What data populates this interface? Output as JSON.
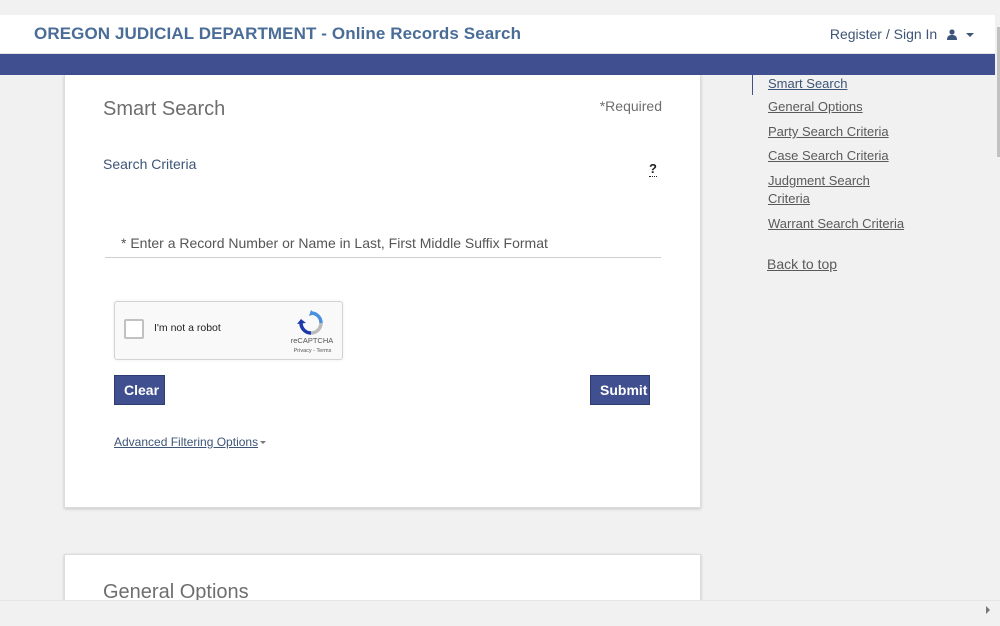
{
  "header": {
    "title": "OREGON JUDICIAL DEPARTMENT - Online Records Search",
    "account_label": "Register / Sign In"
  },
  "smart_search": {
    "title": "Smart Search",
    "required_label": "*Required",
    "criteria_label": "Search Criteria",
    "help_label": "?",
    "search_placeholder": "* Enter a Record Number or Name in Last, First Middle Suffix Format",
    "search_value": "",
    "captcha": {
      "label": "I'm not a robot",
      "brand": "reCAPTCHA",
      "terms": "Privacy - Terms"
    },
    "clear_label": "Clear",
    "submit_label": "Submit",
    "advanced_label": "Advanced Filtering Options"
  },
  "general_options": {
    "title": "General Options"
  },
  "sidenav": {
    "items": [
      {
        "label": "Smart Search"
      },
      {
        "label": "General Options"
      },
      {
        "label": "Party Search Criteria"
      },
      {
        "label": "Case Search Criteria"
      },
      {
        "label": "Judgment Search Criteria"
      },
      {
        "label": "Warrant Search Criteria"
      }
    ],
    "back_to_top": "Back to top"
  },
  "colors": {
    "brand_text": "#4a6d97",
    "nav_bar": "#3f4f8f",
    "button": "#3f4f8f",
    "link": "#3d5577"
  },
  "icons": {
    "account": "user-icon",
    "captcha": "recaptcha-logo-icon"
  }
}
